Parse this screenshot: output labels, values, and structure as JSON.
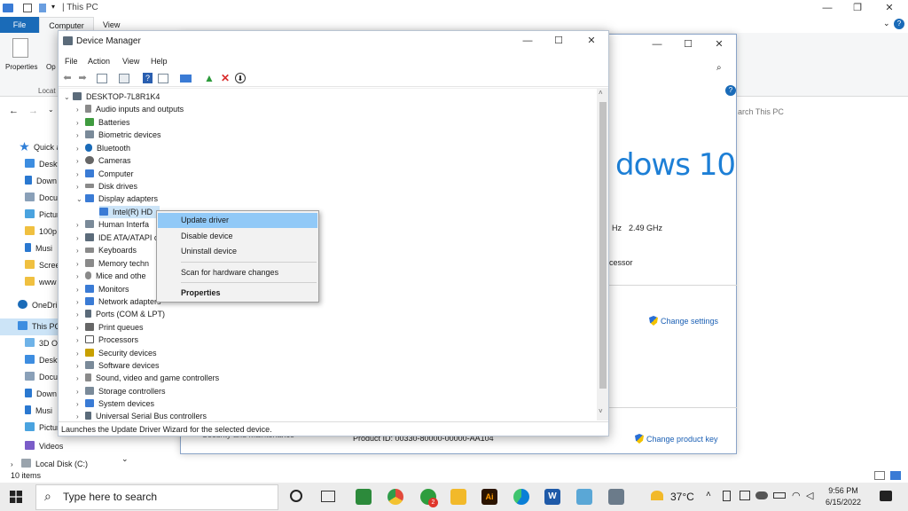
{
  "explorer": {
    "title": "This PC",
    "tabs": {
      "file": "File",
      "computer": "Computer",
      "view": "View"
    },
    "ribbon": {
      "properties": "Properties",
      "open": "Op",
      "location": "Locat"
    },
    "search_placeholder": "arch This PC",
    "sidebar": [
      "Quick a",
      "Deskt",
      "Down",
      "Docu",
      "Pictur",
      "100p",
      "Musi",
      "Scree",
      "www",
      "OneDri",
      "This PC",
      "3D O",
      "Deskt",
      "Docu",
      "Down",
      "Musi",
      "Pictur",
      "Videos",
      "Local Disk (C:)"
    ],
    "status": "10 items"
  },
  "sysprop": {
    "banner": "dows 10",
    "speed_prefix": "Hz",
    "speed_value": "2.49 GHz",
    "processor_fragment": "ocessor",
    "change_settings": "Change settings",
    "security_fragment": "Security and Maintenance",
    "product_id": "Product ID: 00330-80000-00000-AA104",
    "change_product_key": "Change product key"
  },
  "device_manager": {
    "title": "Device Manager",
    "menu": [
      "File",
      "Action",
      "View",
      "Help"
    ],
    "root": "DESKTOP-7L8R1K4",
    "categories": [
      "Audio inputs and outputs",
      "Batteries",
      "Biometric devices",
      "Bluetooth",
      "Cameras",
      "Computer",
      "Disk drives",
      "Display adapters",
      "Intel(R) HD",
      "Human Interfa",
      "IDE ATA/ATAPI c",
      "Keyboards",
      "Memory techn",
      "Mice and othe",
      "Monitors",
      "Network adapters",
      "Ports (COM & LPT)",
      "Print queues",
      "Processors",
      "Security devices",
      "Software devices",
      "Sound, video and game controllers",
      "Storage controllers",
      "System devices",
      "Universal Serial Bus controllers"
    ],
    "status": "Launches the Update Driver Wizard for the selected device."
  },
  "context_menu": {
    "update_driver": "Update driver",
    "disable_device": "Disable device",
    "uninstall_device": "Uninstall device",
    "scan": "Scan for hardware changes",
    "properties": "Properties"
  },
  "taskbar": {
    "search_placeholder": "Type here to search",
    "temperature": "37°C",
    "time": "9:56 PM",
    "date": "6/15/2022",
    "chrome_badge": "2"
  },
  "colors": {
    "accent": "#1a6bb8",
    "menu_highlight": "#91c9f7",
    "win_blue": "#1d7fd6",
    "close_red": "#d92b2b"
  }
}
